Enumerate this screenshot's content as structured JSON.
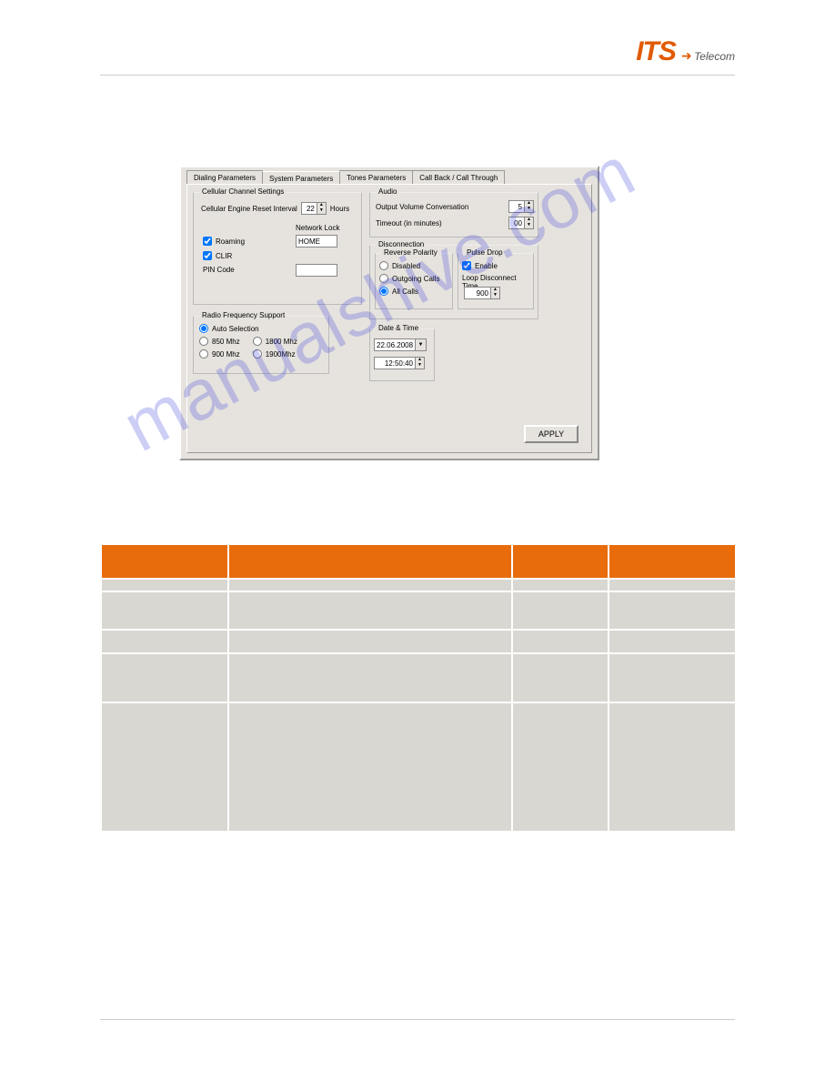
{
  "logo": {
    "its": "ITS",
    "telecom": "Telecom"
  },
  "tabs": [
    {
      "label": "Dialing Parameters"
    },
    {
      "label": "System Parameters"
    },
    {
      "label": "Tones Parameters"
    },
    {
      "label": "Call Back / Call Through"
    }
  ],
  "cellular": {
    "legend": "Cellular Channel Settings",
    "reset_label": "Cellular Engine Reset Interval",
    "reset_value": "22",
    "hours_label": "Hours",
    "network_lock_label": "Network Lock",
    "network_lock_value": "HOME",
    "roaming_label": "Roaming",
    "clir_label": "CLIR",
    "pin_label": "PIN Code",
    "pin_value": ""
  },
  "radio": {
    "legend": "Radio Frequency Support",
    "auto_label": "Auto Selection",
    "f850": "850 Mhz",
    "f1800": "1800 Mhz",
    "f900": "900 Mhz",
    "f1900": "1900Mhz"
  },
  "audio": {
    "legend": "Audio",
    "volume_label": "Output Volume Conversation",
    "volume_value": "5",
    "timeout_label": "Timeout (in minutes)",
    "timeout_value": "00"
  },
  "disconnection": {
    "legend": "Disconnection",
    "reverse": {
      "legend": "Reverse Polarity",
      "disabled": "Disabled",
      "outgoing": "Outgoing Calls",
      "allcalls": "All Calls"
    },
    "pulse": {
      "legend": "Pulse Drop",
      "enable": "Enable",
      "loop_label": "Loop Disconnect Time",
      "loop_value": "900"
    }
  },
  "datetime": {
    "legend": "Date & Time",
    "date": "22.06.2008",
    "time": "12:50:40"
  },
  "apply": "APPLY",
  "watermark": "manualshive.com",
  "table": {
    "headers": [
      "",
      "",
      "",
      ""
    ],
    "rows": [
      [
        "",
        "",
        "",
        ""
      ],
      [
        "",
        "",
        "",
        ""
      ],
      [
        "",
        "",
        "",
        ""
      ],
      [
        "",
        "",
        "",
        ""
      ],
      [
        "",
        "",
        "",
        ""
      ]
    ]
  }
}
